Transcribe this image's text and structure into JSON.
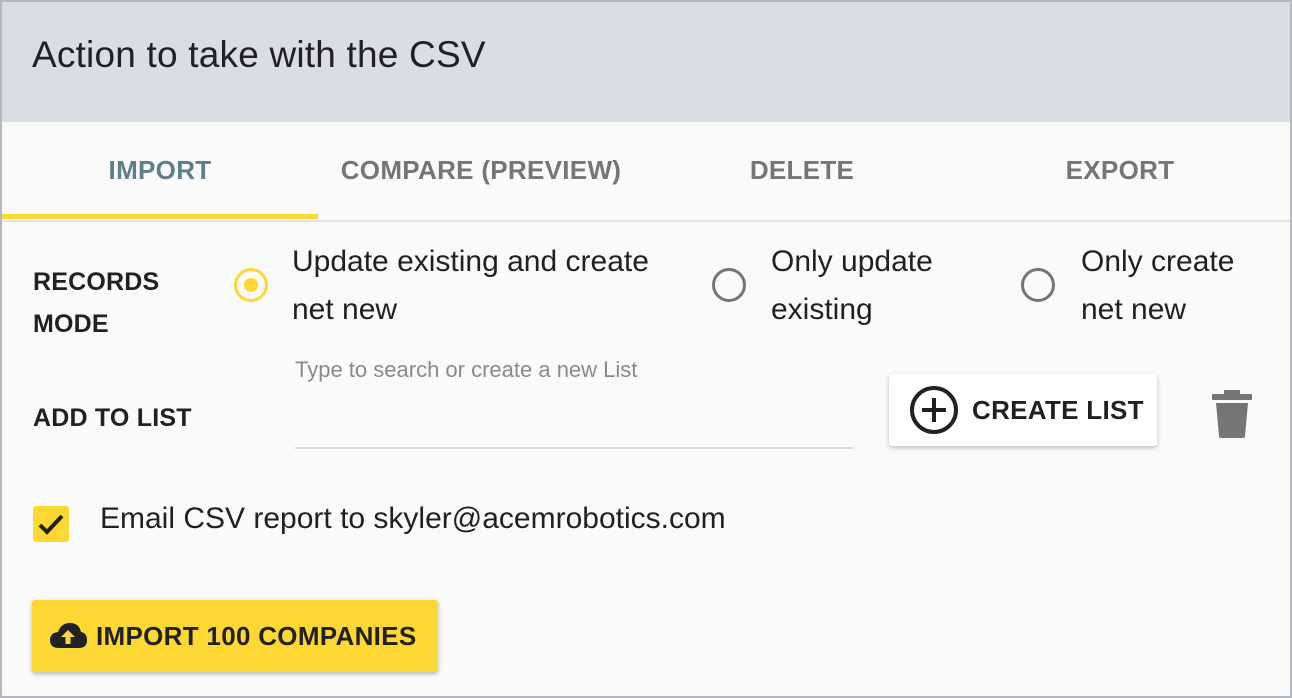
{
  "header": {
    "title": "Action to take with the CSV"
  },
  "tabs": [
    {
      "label": "IMPORT",
      "active": true
    },
    {
      "label": "COMPARE (PREVIEW)",
      "active": false
    },
    {
      "label": "DELETE",
      "active": false
    },
    {
      "label": "EXPORT",
      "active": false
    }
  ],
  "records_mode": {
    "label_line1": "RECORDS",
    "label_line2": "MODE",
    "options": [
      {
        "line1": "Update existing and create",
        "line2": "net new",
        "selected": true
      },
      {
        "line1": "Only update",
        "line2": "existing",
        "selected": false
      },
      {
        "line1": "Only create",
        "line2": "net new",
        "selected": false
      }
    ]
  },
  "add_to_list": {
    "label": "ADD TO LIST",
    "placeholder": "Type to search or create a new List",
    "value": "",
    "create_button_label": "CREATE LIST",
    "create_icon": "add-circle-icon",
    "delete_icon": "trash-icon"
  },
  "email_report": {
    "checked": true,
    "label": "Email CSV report to skyler@acemrobotics.com"
  },
  "import_button": {
    "label": "IMPORT 100 COMPANIES",
    "icon": "cloud-upload-icon"
  },
  "colors": {
    "accent": "#fdd835",
    "header_bg": "#dadee2",
    "active_tab": "#5f7e8c",
    "inactive_tab": "#757575"
  }
}
